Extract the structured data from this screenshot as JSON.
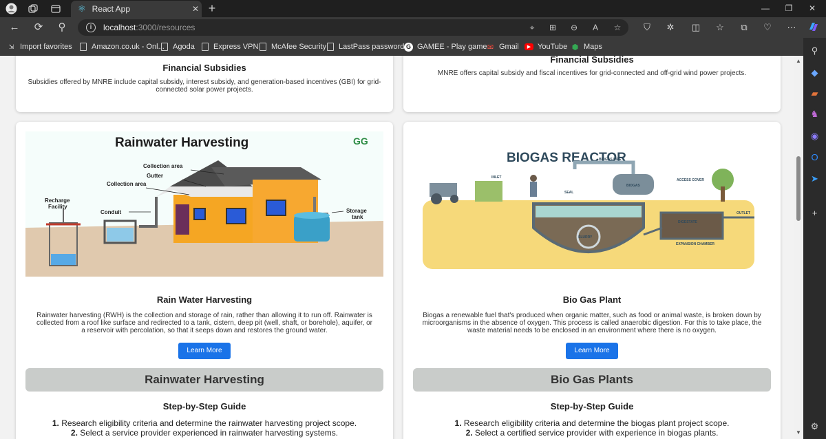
{
  "browser": {
    "tab_title": "React App",
    "url_host": "localhost",
    "url_path": ":3000/resources",
    "bookmarks": [
      {
        "label": "Import favorites"
      },
      {
        "label": "Amazon.co.uk - Onl..."
      },
      {
        "label": "Agoda"
      },
      {
        "label": "Express VPN"
      },
      {
        "label": "McAfee Security"
      },
      {
        "label": "LastPass password..."
      },
      {
        "label": "GAMEE - Play game..."
      },
      {
        "label": "Gmail"
      },
      {
        "label": "YouTube"
      },
      {
        "label": "Maps"
      }
    ]
  },
  "cards_top": [
    {
      "title": "Financial Subsidies",
      "desc": "Subsidies offered by MNRE include capital subsidy, interest subsidy, and generation-based incentives (GBI) for grid-connected solar power projects."
    },
    {
      "title": "Financial Subsidies",
      "desc": "MNRE offers capital subsidy and fiscal incentives for grid-connected and off-grid wind power projects."
    }
  ],
  "cards": [
    {
      "image_title": "Rainwater Harvesting",
      "image_logo": "GG",
      "image_labels": [
        "Collection area",
        "Gutter",
        "Collection area",
        "Recharge",
        "Facility",
        "Conduit",
        "Storage",
        "tank"
      ],
      "title": "Rain Water Harvesting",
      "desc": "Rainwater harvesting (RWH) is the collection and storage of rain, rather than allowing it to run off. Rainwater is collected from a roof like surface and redirected to a tank, cistern, deep pit (well, shaft, or borehole), aquifer, or a reservoir with percolation, so that it seeps down and restores the ground water.",
      "button": "Learn More",
      "section": "Rainwater Harvesting",
      "guide_title": "Step-by-Step Guide",
      "steps": [
        {
          "num": "1.",
          "text": "Research eligibility criteria and determine the rainwater harvesting project scope."
        },
        {
          "num": "2.",
          "text": "Select a service provider experienced in rainwater harvesting systems."
        }
      ]
    },
    {
      "image_title": "BIOGAS REACTOR",
      "image_labels": [
        "BIOGAS PIPE",
        "INLET",
        "SEAL",
        "BIOGAS",
        "ACCESS COVER",
        "OUTLET",
        "DIGESTATE",
        "EXPANSION CHAMBER",
        "SLURRY"
      ],
      "title": "Bio Gas Plant",
      "desc": "Biogas a renewable fuel that's produced when organic matter, such as food or animal waste, is broken down by microorganisms in the absence of oxygen. This process is called anaerobic digestion. For this to take place, the waste material needs to be enclosed in an environment where there is no oxygen.",
      "button": "Learn More",
      "section": "Bio Gas Plants",
      "guide_title": "Step-by-Step Guide",
      "steps": [
        {
          "num": "1.",
          "text": "Research eligibility criteria and determine the biogas plant project scope."
        },
        {
          "num": "2.",
          "text": "Select a certified service provider with experience in biogas plants."
        }
      ]
    }
  ],
  "colors": {
    "accent": "#1a73e8",
    "band": "#c9ccca",
    "page_bg": "#f2f2f2"
  }
}
